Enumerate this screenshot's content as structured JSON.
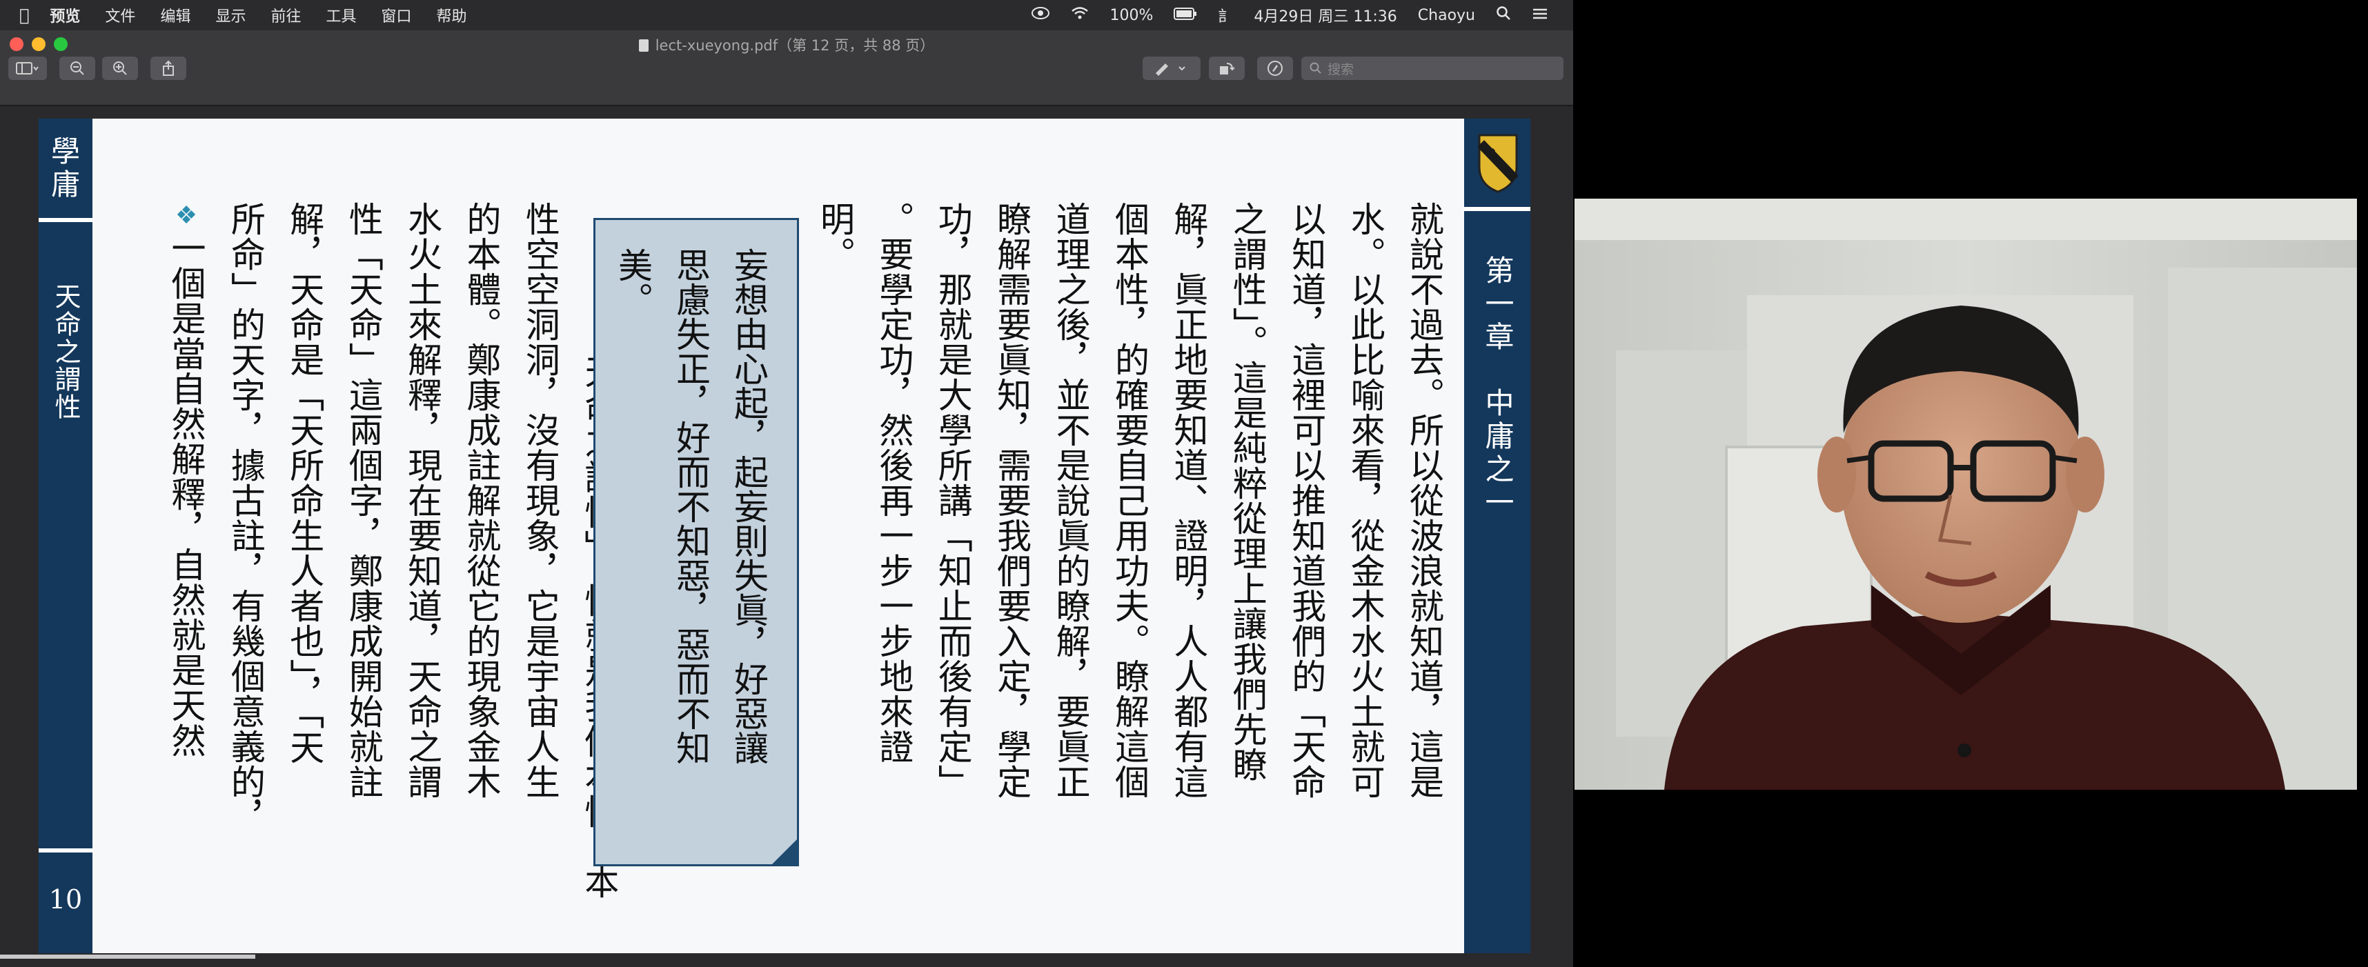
{
  "menubar": {
    "app_name": "预览",
    "items": [
      "文件",
      "编辑",
      "显示",
      "前往",
      "工具",
      "窗口",
      "帮助"
    ],
    "battery": "100%",
    "input_method": "訁",
    "datetime": "4月29日 周三 11:36",
    "user": "Chaoyu"
  },
  "window": {
    "title": "lect-xueyong.pdf（第 12 页，共 88 页）",
    "search_placeholder": "搜索"
  },
  "page": {
    "left_title": "學庸",
    "left_vertical": "天命之謂性",
    "page_number": "10",
    "chapter": "第一章　中庸之一",
    "body_lines": [
      "就說不過去。所以從波浪就知道，這是",
      "水。以此比喻來看，從金木水火土就可",
      "以知道，這裡可以推知道我們的「天命",
      "之謂性」。這是純粹從理上讓我們先瞭",
      "解，眞正地要知道、證明，人人都有這",
      "個本性，的確要自己用功夫。瞭解這個",
      "道理之後，並不是說眞的瞭解，要眞正",
      "瞭解需要眞知，需要我們要入定，學定",
      "功，那就是大學所講「知止而後有定」",
      "。要學定功，然後再一步一步地來證",
      "明。"
    ],
    "body_lines_lower": [
      "「天命之謂性」，性就是我們本性，本",
      "性空空洞洞，沒有現象，它是宇宙人生",
      "的本體。鄭康成註解就從它的現象金木",
      "水火土來解釋，現在要知道，天命之謂",
      "性「天命」這兩個字，鄭康成開始就註",
      "解，天命是「天所命生人者也」，「天",
      "所命」的天字，據古註，有幾個意義的，"
    ],
    "bullet_line": "一個是當自然解釋，自然就是天然",
    "callout_lines": [
      "妄想由心起，起妄則失眞，好惡讓",
      "思慮失正，好而不知惡，惡而不知",
      "美。"
    ]
  }
}
